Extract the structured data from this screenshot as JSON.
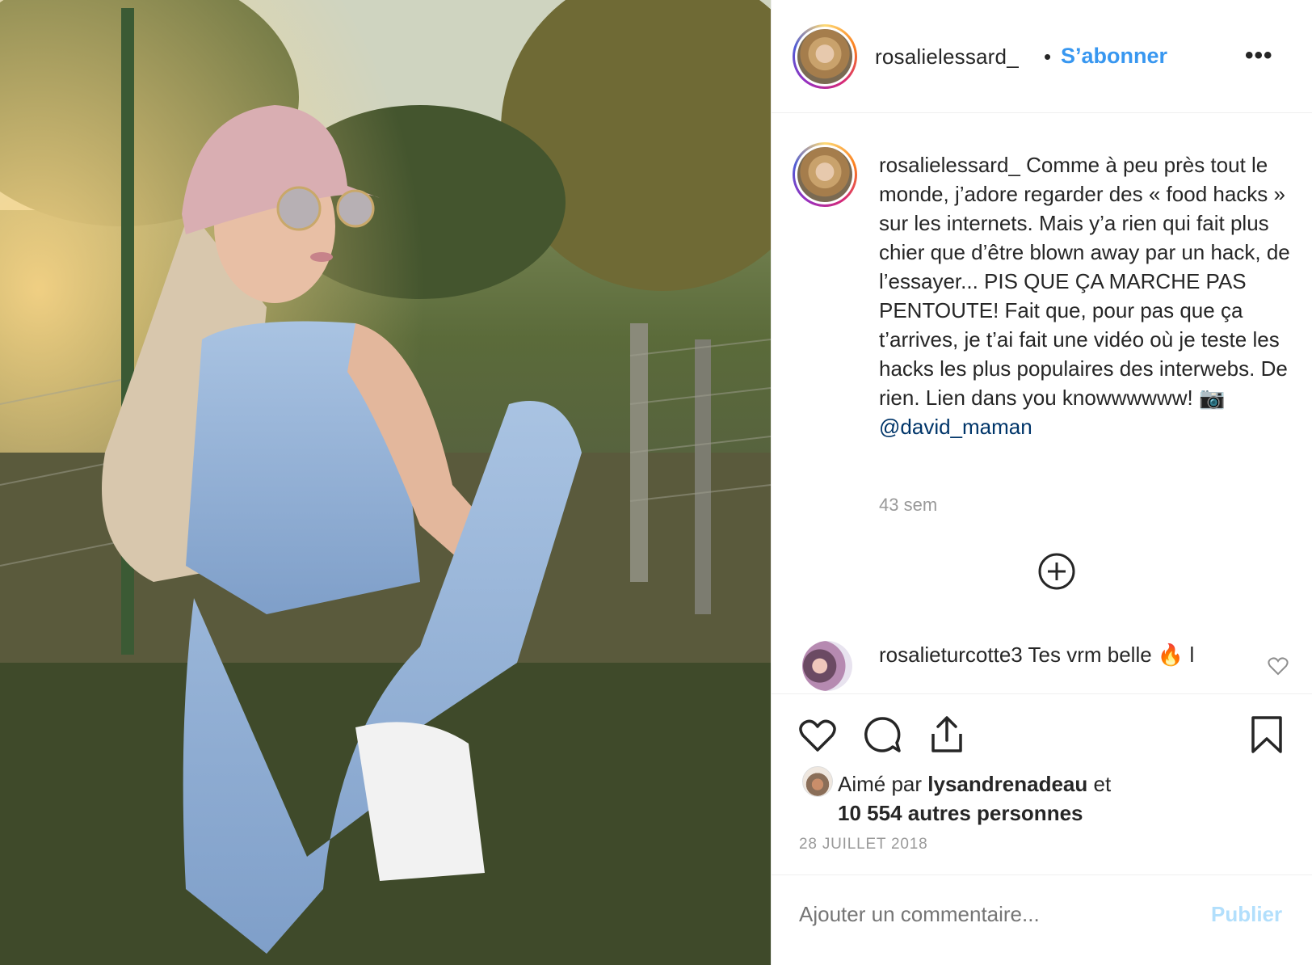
{
  "post": {
    "author": "rosalielessard_",
    "separator": "•",
    "follow_label": "S’abonner",
    "more_label": "•••",
    "caption_text": "Comme à peu près tout le monde, j’adore regarder des « food hacks » sur les internets. Mais y’a rien qui fait plus chier que d’être blown away par un hack, de l’essayer... PIS QUE ÇA MARCHE PAS PENTOUTE! Fait que, pour pas que ça t’arrives, je t’ai fait une vidéo où je teste les hacks les plus populaires des interwebs. De rien. Lien dans you knowwwwww! 📷",
    "mention": "@david_maman",
    "time_ago": "43 sem"
  },
  "comments": [
    {
      "user": "rosalieturcotte3",
      "text": "Tes vrm belle 🔥 l"
    }
  ],
  "likes": {
    "prefix": "Aimé par",
    "user": "lysandrenadeau",
    "joiner": "et",
    "others": "10 554 autres personnes"
  },
  "date": "28 JUILLET 2018",
  "composer": {
    "placeholder": "Ajouter un commentaire...",
    "publish_label": "Publier"
  },
  "icons": {
    "like": "heart-outline-icon",
    "comment": "comment-bubble-icon",
    "share": "share-upload-icon",
    "save": "bookmark-icon",
    "load_more": "plus-circle-icon"
  },
  "colors": {
    "follow": "#3897f0",
    "mention": "#003569",
    "publish_disabled": "#b2dffc",
    "muted": "#999999"
  }
}
